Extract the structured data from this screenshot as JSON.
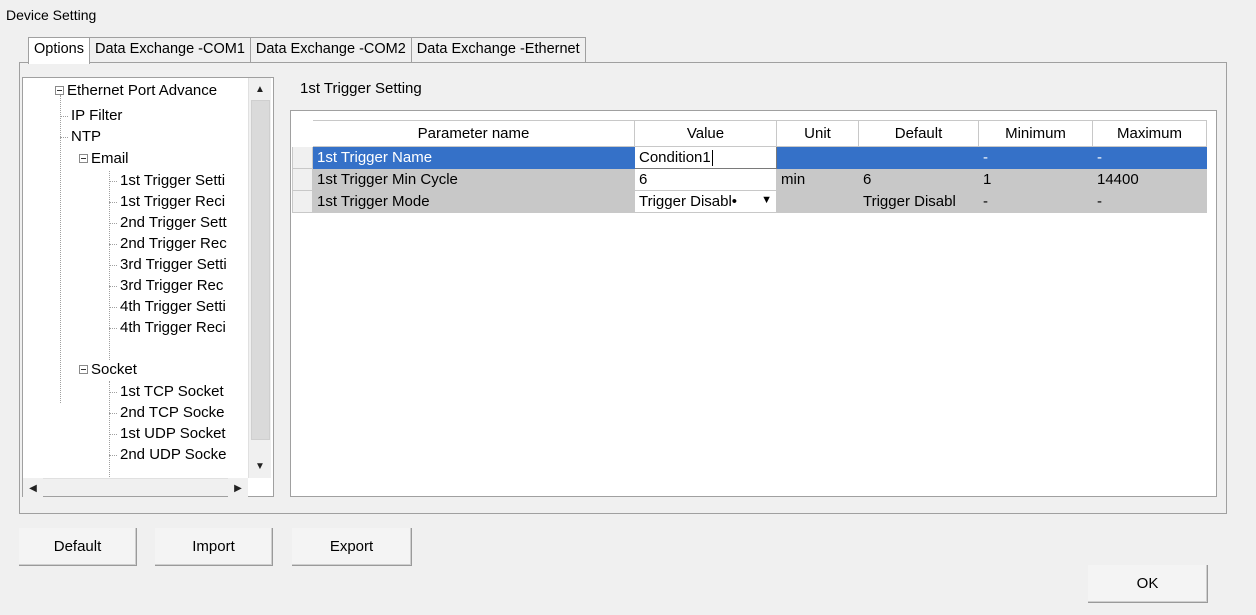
{
  "window": {
    "title": "Device Setting"
  },
  "tabs": [
    {
      "label": "Options",
      "active": true
    },
    {
      "label": "Data Exchange -COM1",
      "active": false
    },
    {
      "label": "Data Exchange -COM2",
      "active": false
    },
    {
      "label": "Data Exchange -Ethernet",
      "active": false
    }
  ],
  "tree": {
    "items": [
      {
        "label": "Ethernet Port Advance",
        "expandable": true
      },
      {
        "label": "IP Filter"
      },
      {
        "label": "NTP"
      },
      {
        "label": "Email",
        "expandable": true
      },
      {
        "label": "1st Trigger Setti"
      },
      {
        "label": "1st Trigger Reci"
      },
      {
        "label": "2nd Trigger Sett"
      },
      {
        "label": "2nd Trigger Rec"
      },
      {
        "label": "3rd Trigger Setti"
      },
      {
        "label": "3rd Trigger Rec"
      },
      {
        "label": "4th Trigger Setti"
      },
      {
        "label": "4th Trigger Reci"
      },
      {
        "label": "Socket",
        "expandable": true
      },
      {
        "label": "1st TCP Socket"
      },
      {
        "label": "2nd TCP Socke"
      },
      {
        "label": "1st UDP Socket"
      },
      {
        "label": "2nd UDP Socke"
      }
    ]
  },
  "main": {
    "section_title": "1st Trigger Setting",
    "columns": [
      "Parameter name",
      "Value",
      "Unit",
      "Default",
      "Minimum",
      "Maximum"
    ],
    "rows": [
      {
        "name": "1st Trigger Name",
        "value": "Condition1",
        "unit": "",
        "default": "",
        "minimum": "-",
        "maximum": "-"
      },
      {
        "name": "1st Trigger Min Cycle",
        "value": "6",
        "unit": "min",
        "default": "6",
        "minimum": "1",
        "maximum": "14400"
      },
      {
        "name": "1st Trigger Mode",
        "value": "Trigger Disabl•",
        "unit": "",
        "default": "Trigger Disabl",
        "minimum": "-",
        "maximum": "-"
      }
    ]
  },
  "buttons": {
    "default": "Default",
    "import": "Import",
    "export": "Export",
    "ok": "OK"
  },
  "colors": {
    "selection": "#3571c8",
    "row_gray": "#c8c8c8",
    "background": "#f0f0f0"
  }
}
